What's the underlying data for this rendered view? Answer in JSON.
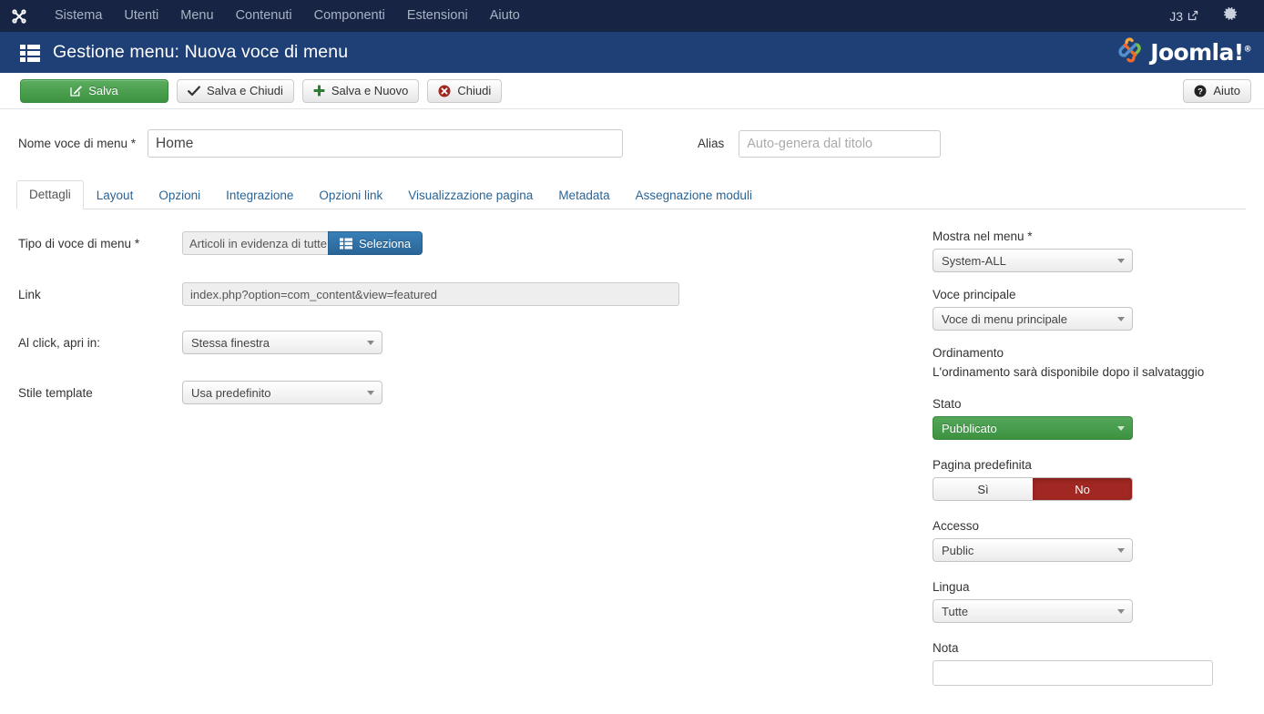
{
  "topnav": {
    "brand_icon": "joomla-mark-icon",
    "items": [
      {
        "label": "Sistema"
      },
      {
        "label": "Utenti"
      },
      {
        "label": "Menu"
      },
      {
        "label": "Contenuti"
      },
      {
        "label": "Componenti"
      },
      {
        "label": "Estensioni"
      },
      {
        "label": "Aiuto"
      }
    ],
    "site_link_label": "J3",
    "site_link_icon": "external-link-icon",
    "settings_icon": "gear-icon"
  },
  "header": {
    "icon": "menu-list-icon",
    "title": "Gestione menu: Nuova voce di menu",
    "logo_text": "Joomla!",
    "logo_trademark": "®",
    "logo_icon": "joomla-logo-icon"
  },
  "toolbar": {
    "save_label": "Salva",
    "save_icon": "edit-pencil-icon",
    "save_close_label": "Salva e Chiudi",
    "save_close_icon": "check-icon",
    "save_new_label": "Salva e Nuovo",
    "save_new_icon": "plus-icon",
    "close_label": "Chiudi",
    "close_icon": "close-circle-icon",
    "help_label": "Aiuto",
    "help_icon": "help-circle-icon"
  },
  "form": {
    "name_label": "Nome voce di menu *",
    "name_value": "Home",
    "alias_label": "Alias",
    "alias_value": "",
    "alias_placeholder": "Auto-genera dal titolo"
  },
  "tabs": [
    {
      "label": "Dettagli",
      "active": true
    },
    {
      "label": "Layout",
      "active": false
    },
    {
      "label": "Opzioni",
      "active": false
    },
    {
      "label": "Integrazione",
      "active": false
    },
    {
      "label": "Opzioni link",
      "active": false
    },
    {
      "label": "Visualizzazione pagina",
      "active": false
    },
    {
      "label": "Metadata",
      "active": false
    },
    {
      "label": "Assegnazione moduli",
      "active": false
    }
  ],
  "details": {
    "type_label": "Tipo di voce di menu *",
    "type_value": "Articoli in evidenza di tutte",
    "select_button_label": "Seleziona",
    "select_button_icon": "list-icon",
    "link_label": "Link",
    "link_value": "index.php?option=com_content&view=featured",
    "target_label": "Al click, apri in:",
    "target_value": "Stessa finestra",
    "template_label": "Stile template",
    "template_value": "Usa predefinito"
  },
  "sidebar": {
    "menu_label": "Mostra nel menu *",
    "menu_value": "System-ALL",
    "parent_label": "Voce principale",
    "parent_value": "Voce di menu principale",
    "ordering_label": "Ordinamento",
    "ordering_note": "L'ordinamento sarà disponibile dopo il salvataggio",
    "status_label": "Stato",
    "status_value": "Pubblicato",
    "default_page_label": "Pagina predefinita",
    "default_page_yes": "Sì",
    "default_page_no": "No",
    "default_page_selected": "No",
    "access_label": "Accesso",
    "access_value": "Public",
    "language_label": "Lingua",
    "language_value": "Tutte",
    "note_label": "Nota",
    "note_value": ""
  },
  "colors": {
    "topnav_bg": "#182444",
    "header_bg": "#1f4076",
    "accent_green": "#3d9241",
    "accent_blue": "#2a6496",
    "accent_red": "#a02722",
    "link_blue": "#2a6496"
  }
}
